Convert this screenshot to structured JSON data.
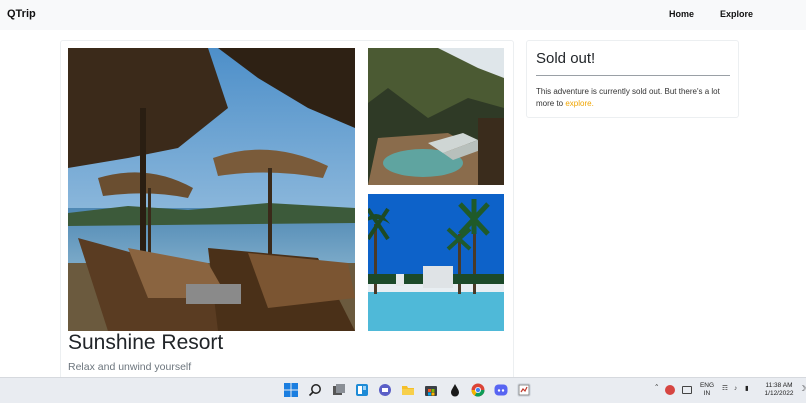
{
  "navbar": {
    "brand": "QTrip",
    "links": [
      "Home",
      "Explore"
    ]
  },
  "adventure": {
    "title": "Sunshine Resort",
    "subtitle": "Relax and unwind yourself",
    "images": [
      "beach-umbrellas-photo",
      "pool-loungers-photo",
      "palm-pool-photo"
    ]
  },
  "reservation": {
    "heading": "Sold out!",
    "message_prefix": "This adventure is currently sold out. But there's a lot more to ",
    "link_text": "explore.",
    "link_color": "#f0a500"
  },
  "taskbar": {
    "language": "ENG",
    "region": "IN",
    "time": "11:38 AM",
    "date": "1/12/2022",
    "icons": [
      "windows-start-icon",
      "search-icon",
      "task-view-icon",
      "widgets-icon",
      "teams-chat-icon",
      "file-explorer-icon",
      "store-icon",
      "app-icon",
      "chrome-icon",
      "discord-icon",
      "active-app-icon"
    ]
  }
}
